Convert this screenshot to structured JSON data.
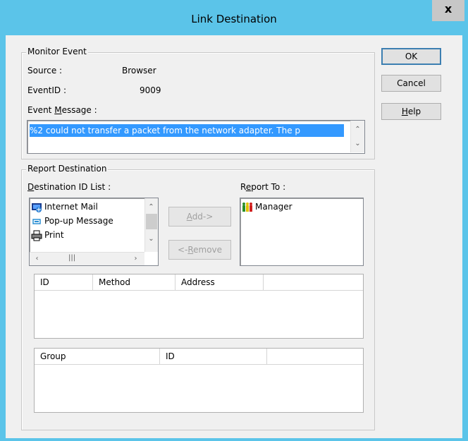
{
  "window": {
    "title": "Link Destination",
    "close_glyph": "x"
  },
  "monitor_event": {
    "group_label": "Monitor Event",
    "source_label": "Source :",
    "source_value": "Browser",
    "eventid_label": "EventID :",
    "eventid_value": "9009",
    "message_label_pre": "Event ",
    "message_label_u": "M",
    "message_label_post": "essage :",
    "message_text": "%2 could not transfer a packet from the network adapter.  The p"
  },
  "buttons": {
    "ok": "OK",
    "cancel": "Cancel",
    "help_u": "H",
    "help_rest": "elp",
    "add_u": "A",
    "add_rest": "dd->",
    "remove_pre": "<-",
    "remove_u": "R",
    "remove_rest": "emove"
  },
  "report_destination": {
    "group_label": "Report Destination",
    "dest_list_label_u": "D",
    "dest_list_label_rest": "estination ID List :",
    "report_to_label_pre": "R",
    "report_to_label_u": "e",
    "report_to_label_rest": "port To :",
    "destination_items": [
      {
        "label": "Internet Mail",
        "icon": "internet-mail-icon"
      },
      {
        "label": "Pop-up Message",
        "icon": "popup-message-icon"
      },
      {
        "label": "Print",
        "icon": "printer-icon"
      }
    ],
    "report_to_items": [
      {
        "label": "Manager",
        "icon": "group-people-icon"
      }
    ],
    "table1_headers": [
      "ID",
      "Method",
      "Address"
    ],
    "table2_headers": [
      "Group",
      "ID"
    ]
  },
  "colors": {
    "title_bar": "#5bc4e9",
    "selection": "#3399ff",
    "selection_text": "#ffffff"
  }
}
